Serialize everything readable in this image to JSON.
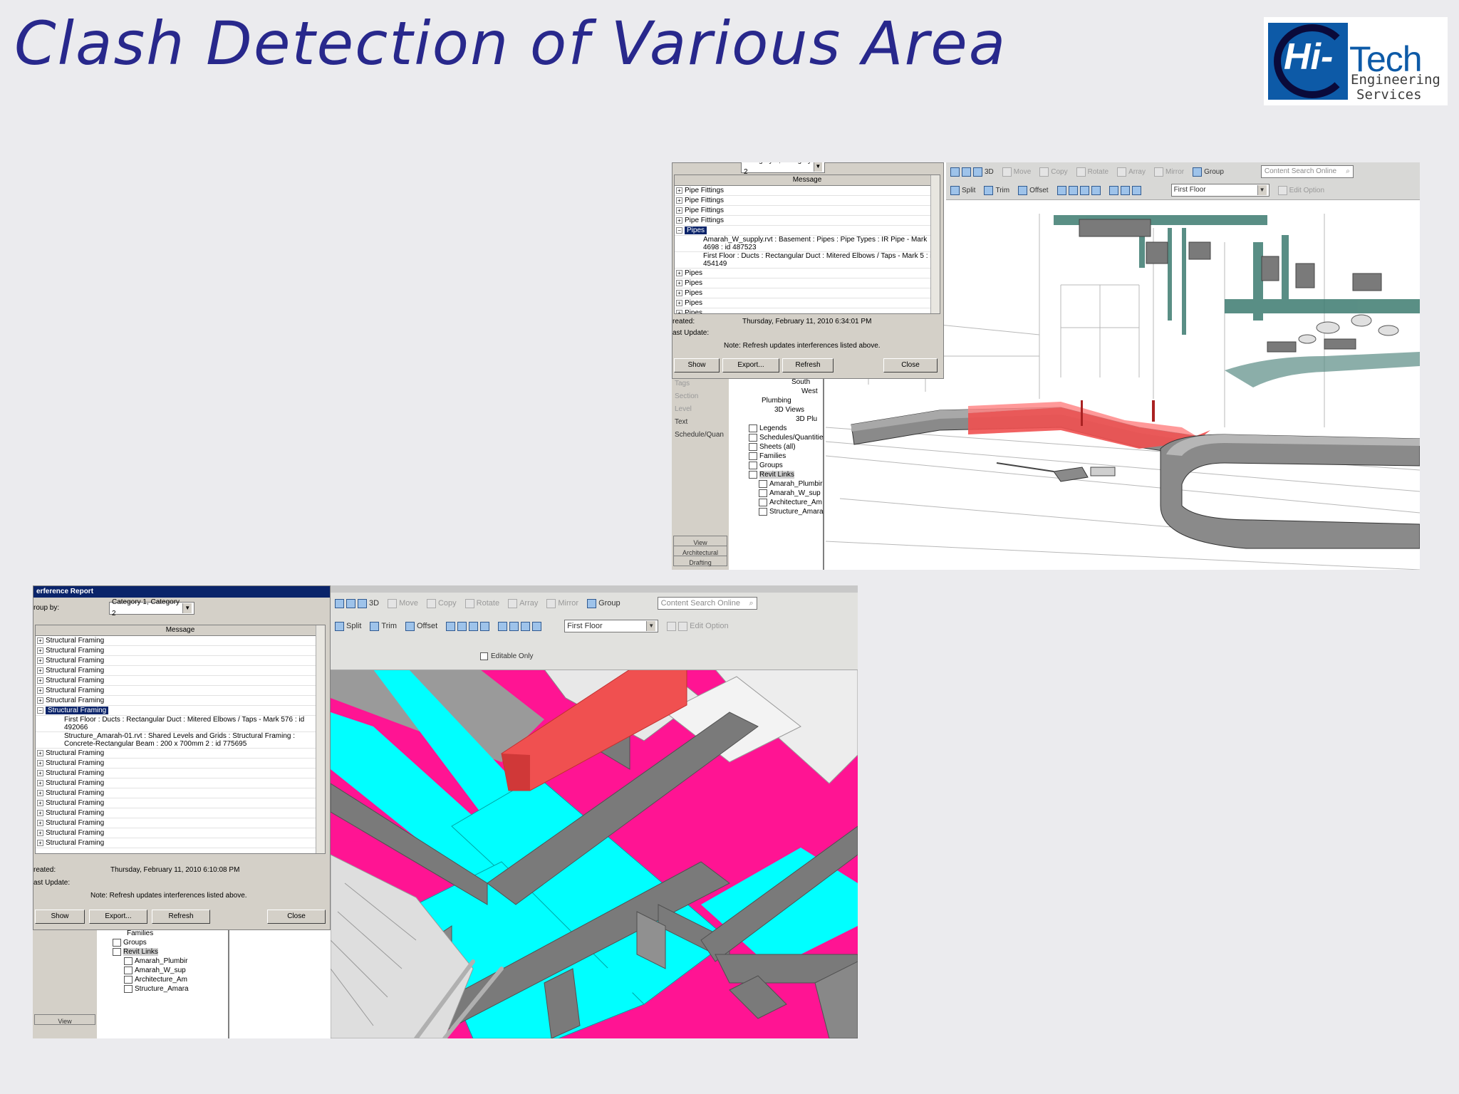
{
  "slide_title": "Clash Detection of Various Area",
  "logo": {
    "hi": "Hi-",
    "tech": "Tech",
    "line1": "Engineering",
    "line2": "Services"
  },
  "colors": {
    "title": "#28288c",
    "clash_red": "#f05050",
    "duct_cyan": "#00ffff",
    "structure_magenta": "#ff1493",
    "selection": "#0a246a"
  },
  "shot1": {
    "dialog": {
      "group_by_value": "Category 1, Category 2",
      "message_header": "Message",
      "rows_before": [
        "Pipe Fittings",
        "Pipe Fittings",
        "Pipe Fittings",
        "Pipe Fittings"
      ],
      "selected": "Pipes",
      "child1": "Amarah_W_supply.rvt : Basement : Pipes : Pipe Types : IR Pipe - Mark 4698 : id 487523",
      "child2": "First Floor : Ducts : Rectangular Duct : Mitered Elbows / Taps - Mark 5 : id 454149",
      "rows_after": [
        "Pipes",
        "Pipes",
        "Pipes",
        "Pipes",
        "Pipes"
      ],
      "created_label": "reated:",
      "created_value": "Thursday, February 11, 2010 6:34:01 PM",
      "update_label": "ast Update:",
      "note": "Note: Refresh updates interferences listed above.",
      "btn_show": "Show",
      "btn_export": "Export...",
      "btn_refresh": "Refresh",
      "btn_close": "Close"
    },
    "ribbon": {
      "row1": [
        "3D",
        "Move",
        "Copy",
        "Rotate",
        "Array",
        "Mirror",
        "Group"
      ],
      "row2": [
        "Split",
        "Trim",
        "Offset"
      ],
      "search_placeholder": "Content Search Online",
      "level": "First Floor",
      "edit_option": "Edit Option"
    },
    "panel_items": [
      "Tags",
      "Section",
      "Level",
      "Text",
      "Schedule/Quan"
    ],
    "panel_tabs": [
      "View",
      "Architectural",
      "Drafting"
    ],
    "tree_items": [
      "South",
      "West",
      "Plumbing",
      "3D Views",
      "3D Plu",
      "Legends",
      "Schedules/Quantitie",
      "Sheets (all)",
      "Families",
      "Groups",
      "Revit Links",
      "Amarah_Plumbir",
      "Amarah_W_sup",
      "Architecture_Am",
      "Structure_Amara"
    ]
  },
  "shot2": {
    "dialog": {
      "title": "erference Report",
      "group_by_label": "roup by:",
      "group_by_value": "Category 1, Category 2",
      "message_header": "Message",
      "rows_before": [
        "Structural Framing",
        "Structural Framing",
        "Structural Framing",
        "Structural Framing",
        "Structural Framing",
        "Structural Framing",
        "Structural Framing"
      ],
      "selected": "Structural Framing",
      "child1": "First Floor : Ducts : Rectangular Duct : Mitered Elbows / Taps - Mark 576 : id 492066",
      "child2": "Structure_Amarah-01.rvt : Shared Levels and Grids : Structural Framing : Concrete-Rectangular Beam : 200 x 700mm 2 : id 775695",
      "rows_after": [
        "Structural Framing",
        "Structural Framing",
        "Structural Framing",
        "Structural Framing",
        "Structural Framing",
        "Structural Framing",
        "Structural Framing",
        "Structural Framing",
        "Structural Framing",
        "Structural Framing"
      ],
      "created_label": "reated:",
      "created_value": "Thursday, February 11, 2010 6:10:08 PM",
      "update_label": "ast Update:",
      "note": "Note: Refresh updates interferences listed above.",
      "btn_show": "Show",
      "btn_export": "Export...",
      "btn_refresh": "Refresh",
      "btn_close": "Close"
    },
    "ribbon": {
      "row1": [
        "3D",
        "Move",
        "Copy",
        "Rotate",
        "Array",
        "Mirror",
        "Group"
      ],
      "row2": [
        "Split",
        "Trim",
        "Offset"
      ],
      "search_placeholder": "Content Search Online",
      "level": "First Floor",
      "edit_option": "Edit Option",
      "editable_only": "Editable Only"
    },
    "tree_items": [
      "Families",
      "Groups",
      "Revit Links",
      "Amarah_Plumbir",
      "Amarah_W_sup",
      "Architecture_Am",
      "Structure_Amara"
    ],
    "panel_tab": "View"
  }
}
